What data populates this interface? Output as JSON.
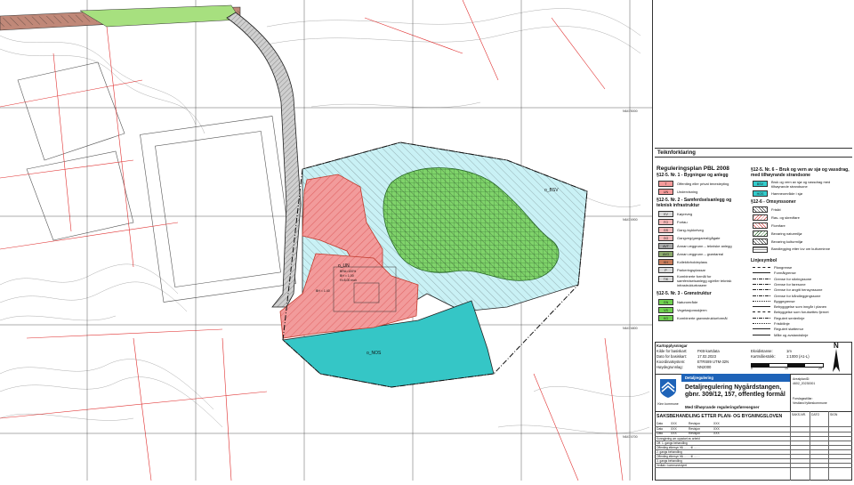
{
  "map": {
    "zones": [
      {
        "name": "o_BSV",
        "code": "BSV"
      },
      {
        "name": "o_UN",
        "code": "UN"
      },
      {
        "name": "o_NOS",
        "code": "NOS"
      }
    ],
    "zone_notes": [
      "BRA=100%",
      "BH = 1.00",
      "H=8.00 moh",
      "BH = 1.40"
    ],
    "coordinates": [
      "N6475000",
      "N6474900",
      "N6474800",
      "N6474700"
    ],
    "colors": {
      "public": "#f08080",
      "green": "#7fd36a",
      "water_light": "#c9f1f5",
      "water_sea": "#35c6c6",
      "road_hatch": "#b8b8b8",
      "earth": "#c08070"
    }
  },
  "legend": {
    "header": "Teiknforklaring",
    "title": "Reguleringsplan PBL 2008",
    "sec1": "§12-5. Nr. 1 - Bygningar og anlegg",
    "items1": [
      {
        "code": "T",
        "label": "Offentleg eller privat tenesteyting",
        "color": "#f59a9a"
      },
      {
        "code": "UN",
        "label": "Undervisning",
        "color": "#f59a9a"
      }
    ],
    "sec2": "§12-5. Nr. 2 - Samferdselsanlegg og teknisk infrastruktur",
    "items2": [
      {
        "code": "KV",
        "label": "Køyreveg",
        "color": "#d9d9d9"
      },
      {
        "code": "FO",
        "label": "Fortau",
        "color": "#f5b8b8"
      },
      {
        "code": "GS",
        "label": "Gang-/sykkelveg",
        "color": "#f5b8b8"
      },
      {
        "code": "GG",
        "label": "Gangveg/gangareal/gågate",
        "color": "#f5b8b8"
      },
      {
        "code": "AVT",
        "label": "Annan veggrunn – tekniske anlegg",
        "color": "#a6a6a6"
      },
      {
        "code": "AVG",
        "label": "Annan veggrunn – grøntareal",
        "color": "#8aa86a"
      },
      {
        "code": "KH",
        "label": "Kollektivholdeplass",
        "color": "#c87c5a"
      },
      {
        "code": "P",
        "label": "Parkeringsplassar",
        "color": "#d9d9d9"
      },
      {
        "code": "TIK",
        "label": "Kombinerte formål for samferdselsanlegg og/eller teknisk infrastrukturtraseer",
        "color": "#d9d9d9"
      }
    ],
    "sec3": "§12-5. Nr. 3 - Grønstruktur",
    "items3": [
      {
        "code": "GN",
        "label": "Naturområde",
        "color": "#6fd14f"
      },
      {
        "code": "VS",
        "label": "Vegetasjonsskjerm",
        "color": "#6fd14f"
      },
      {
        "code": "KG",
        "label": "Kombinerte grønnstrukturformål",
        "color": "#6fd14f"
      }
    ],
    "sec6": "§12-5. Nr. 6 – Bruk og vern av sjø og vassdrag, med tilhøyrande strandsone",
    "items6": [
      {
        "code": "BSV",
        "label": "Bruk og vern av sjø og vassdrag med tilhøyrande strandsone",
        "color": "#33cccc"
      },
      {
        "code": "HOS",
        "label": "Hamneområde i sjø",
        "color": "#33cccc"
      }
    ],
    "sec_omsyn": "§12-6 - Omsynssoner",
    "items_omsyn": [
      {
        "label": "Frisikt"
      },
      {
        "label": "Ras- og skredfare"
      },
      {
        "label": "Flomfare"
      },
      {
        "label": "Bevaring naturmiljø"
      },
      {
        "label": "Bevaring kulturmiljø"
      },
      {
        "label": "Bandlegging etter lov om kulturminne"
      }
    ],
    "sec_lines": "Linjesymbol",
    "lines": [
      "Plangrense",
      "Formålgrense",
      "Grense for sikringssone",
      "Grense for faresone",
      "Grense for angitt hensynssone",
      "Grense for båndleggingssone",
      "Byggegrense",
      "Bebygggelse som inngår i planen",
      "Bebyggelse som forutsettes fjernet",
      "Regulert senterlinje",
      "Frisiktlinje",
      "Regulert støttemur",
      "Måle og avstandslinje"
    ]
  },
  "titleblock": {
    "kartopplysningar": "Kartopplysningar",
    "rows_left": [
      {
        "k": "Kilde for basiskart:",
        "v": "FKB-kartdata"
      },
      {
        "k": "Dato for basiskart:",
        "v": "17.02.2023"
      },
      {
        "k": "Koordinatsystem:",
        "v": "ETRS89 UTM-32N"
      },
      {
        "k": "Høydegrunnlag:",
        "v": "NN2000"
      }
    ],
    "rows_right": [
      {
        "k": "Ekvidistanse:",
        "v": "1m"
      },
      {
        "k": "Kartmålestokk:",
        "v": "1:1000 (A1-L)"
      }
    ],
    "scale_ticks": [
      "0",
      "10",
      "20"
    ],
    "north": "N",
    "detaljregulering": "Detaljregulering",
    "plan_title": "Detaljregulering Nygårdstangen, gbnr. 309/12, 157, offentleg formål",
    "plan_subtitle": "Med tilhøyrande reguleringsføresegner",
    "kommune": "Kinn kommune",
    "arkivplan_label": "ArealplanID:",
    "arkivplan_id": "4602_20230001",
    "forslagsstillar_label": "Forslagsstillar:",
    "forslagsstillar": "Vestland fylkeskommune",
    "saksbehandling": "SAKSBEHANDLING ETTER PLAN- OG BYGNINGSLOVEN",
    "saks_cols": [
      "SAKS-NR.",
      "DATO",
      "SIGN"
    ],
    "rev_rows": [
      {
        "d": "Dato",
        "x": "XXX",
        "r": "Revisjon",
        "v": "XXX"
      },
      {
        "d": "Dato",
        "x": "XXX",
        "r": "Revisjon",
        "v": "XXX"
      },
      {
        "d": "Dato",
        "x": "XXX",
        "r": "Revisjon",
        "v": "XXX"
      }
    ],
    "process_rows": [
      "Kunngjering om oppstart av arbeid",
      "Off. 1. gangs behandling",
      "Offentleg ettersyn frå ........ til ........",
      "2. gangs behandling",
      "Offentleg ettersyn frå ........ til ........",
      "3. gangs behandling",
      "Vedtak i kommunestyret"
    ]
  }
}
